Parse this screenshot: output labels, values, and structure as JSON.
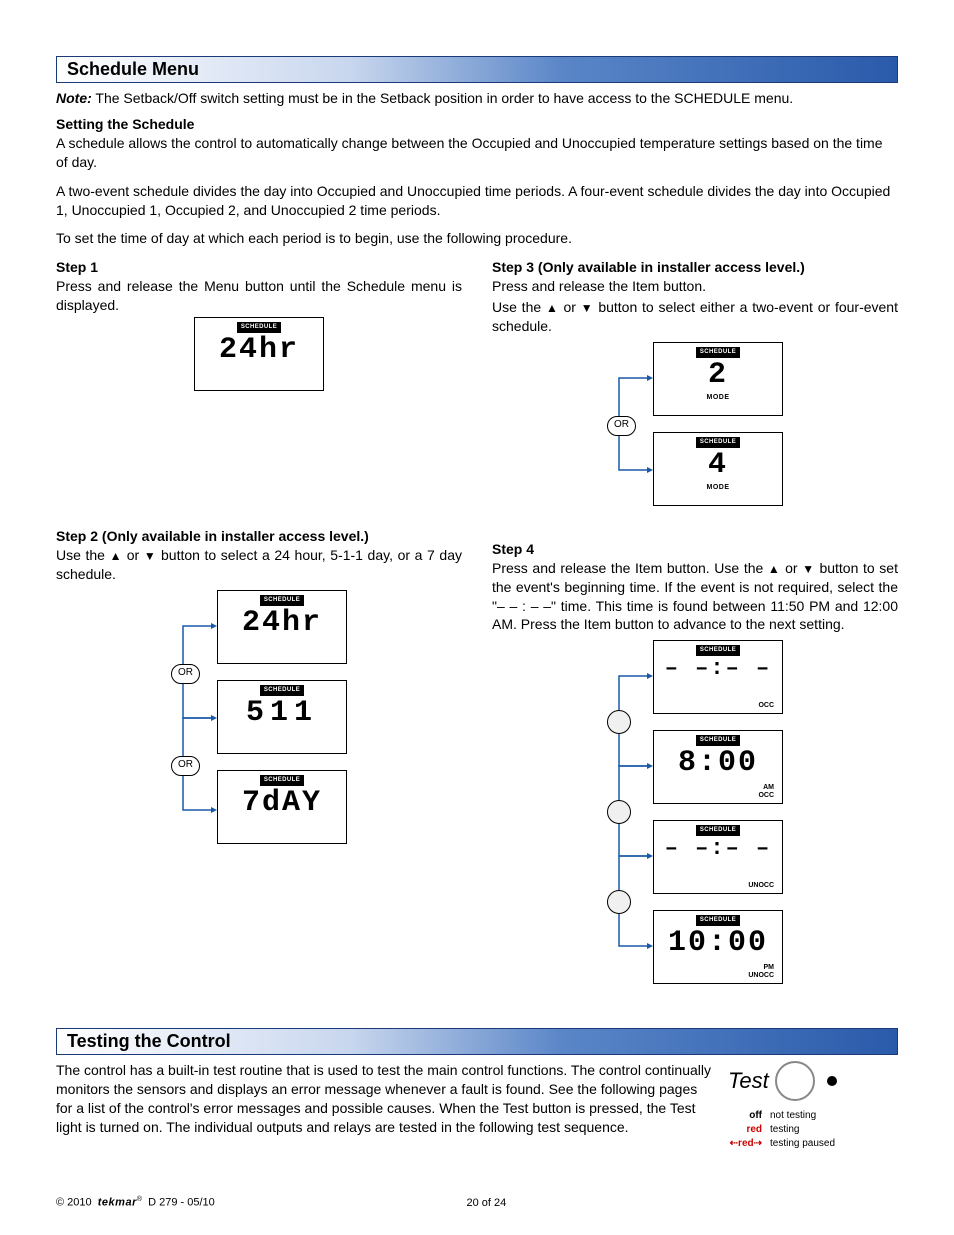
{
  "headers": {
    "schedule": "Schedule Menu",
    "testing": "Testing the Control"
  },
  "note": {
    "label": "Note:",
    "text": "The Setback/Off switch setting must be in the Setback position in order to have access to the SCHEDULE menu."
  },
  "setting": {
    "subhead": "Setting the Schedule",
    "p1": "A schedule allows the control to automatically change between the Occupied and Unoccupied temperature settings based on the time of day.",
    "p2": "A two-event schedule divides the day into Occupied and Unoccupied  time periods. A four-event schedule divides the day into Occupied 1, Unoccupied 1, Occupied 2, and Unoccupied 2 time periods.",
    "p3": "To set the time of day at which each period is to begin, use the following procedure."
  },
  "steps": {
    "s1": {
      "title": "Step 1",
      "text": "Press and release the Menu button until the Schedule menu is displayed.",
      "lcd": {
        "label": "SCHEDULE",
        "value": "24hr"
      }
    },
    "s2": {
      "title": "Step 2 (Only available in installer access level.)",
      "text_a": "Use the ",
      "text_b": " or ",
      "text_c": " button to select a 24 hour, 5-1-1 day, or a 7 day schedule.",
      "or": "OR",
      "lcd1": {
        "label": "SCHEDULE",
        "value": "24hr"
      },
      "lcd2": {
        "label": "SCHEDULE",
        "value": "511"
      },
      "lcd3": {
        "label": "SCHEDULE",
        "value": "7dAY"
      }
    },
    "s3": {
      "title": "Step 3 (Only available in installer access level.)",
      "text1": "Press and release the Item button.",
      "text2_a": "Use the ",
      "text2_b": " or ",
      "text2_c": " button to select either a two-event or four-event schedule.",
      "or": "OR",
      "lcd1": {
        "label": "SCHEDULE",
        "value": "2",
        "mode": "MODE"
      },
      "lcd2": {
        "label": "SCHEDULE",
        "value": "4",
        "mode": "MODE"
      }
    },
    "s4": {
      "title": "Step 4",
      "text_a": "Press and release the Item button. Use the ",
      "text_b": " or ",
      "text_c": " button to set the event's beginning time. If the event is not required, select the \"– – : – –\" time. This time is found between 11:50 PM and 12:00 AM. Press the Item button to advance to the next setting.",
      "lcd1": {
        "label": "SCHEDULE",
        "value": "– –:– –",
        "sub": "OCC"
      },
      "lcd2": {
        "label": "SCHEDULE",
        "value": "8:00",
        "sub": "AM\nOCC"
      },
      "lcd3": {
        "label": "SCHEDULE",
        "value": "– –:– –",
        "sub": "UNOCC"
      },
      "lcd4": {
        "label": "SCHEDULE",
        "value": "10:00",
        "sub": "PM\nUNOCC"
      }
    }
  },
  "testing": {
    "p1": "The control has a built-in test routine that is used to test the main control functions. The control continually monitors the sensors and displays an error message whenever a fault is found. See the following pages for a list of the control's error messages and possible causes. When the Test button is pressed, the Test light is turned on. The individual outputs and relays are tested in the following test sequence.",
    "label": "Test",
    "legend": {
      "off": {
        "label": "off",
        "desc": "not testing"
      },
      "red": {
        "label": "red",
        "desc": "testing"
      },
      "redblink": {
        "label": "red",
        "desc": "testing paused"
      }
    }
  },
  "footer": {
    "copyright": "© 2010",
    "brand": "tekmar",
    "doc": "D 279 - 05/10",
    "page": "20 of 24"
  },
  "glyphs": {
    "up": "▲",
    "down": "▼"
  }
}
